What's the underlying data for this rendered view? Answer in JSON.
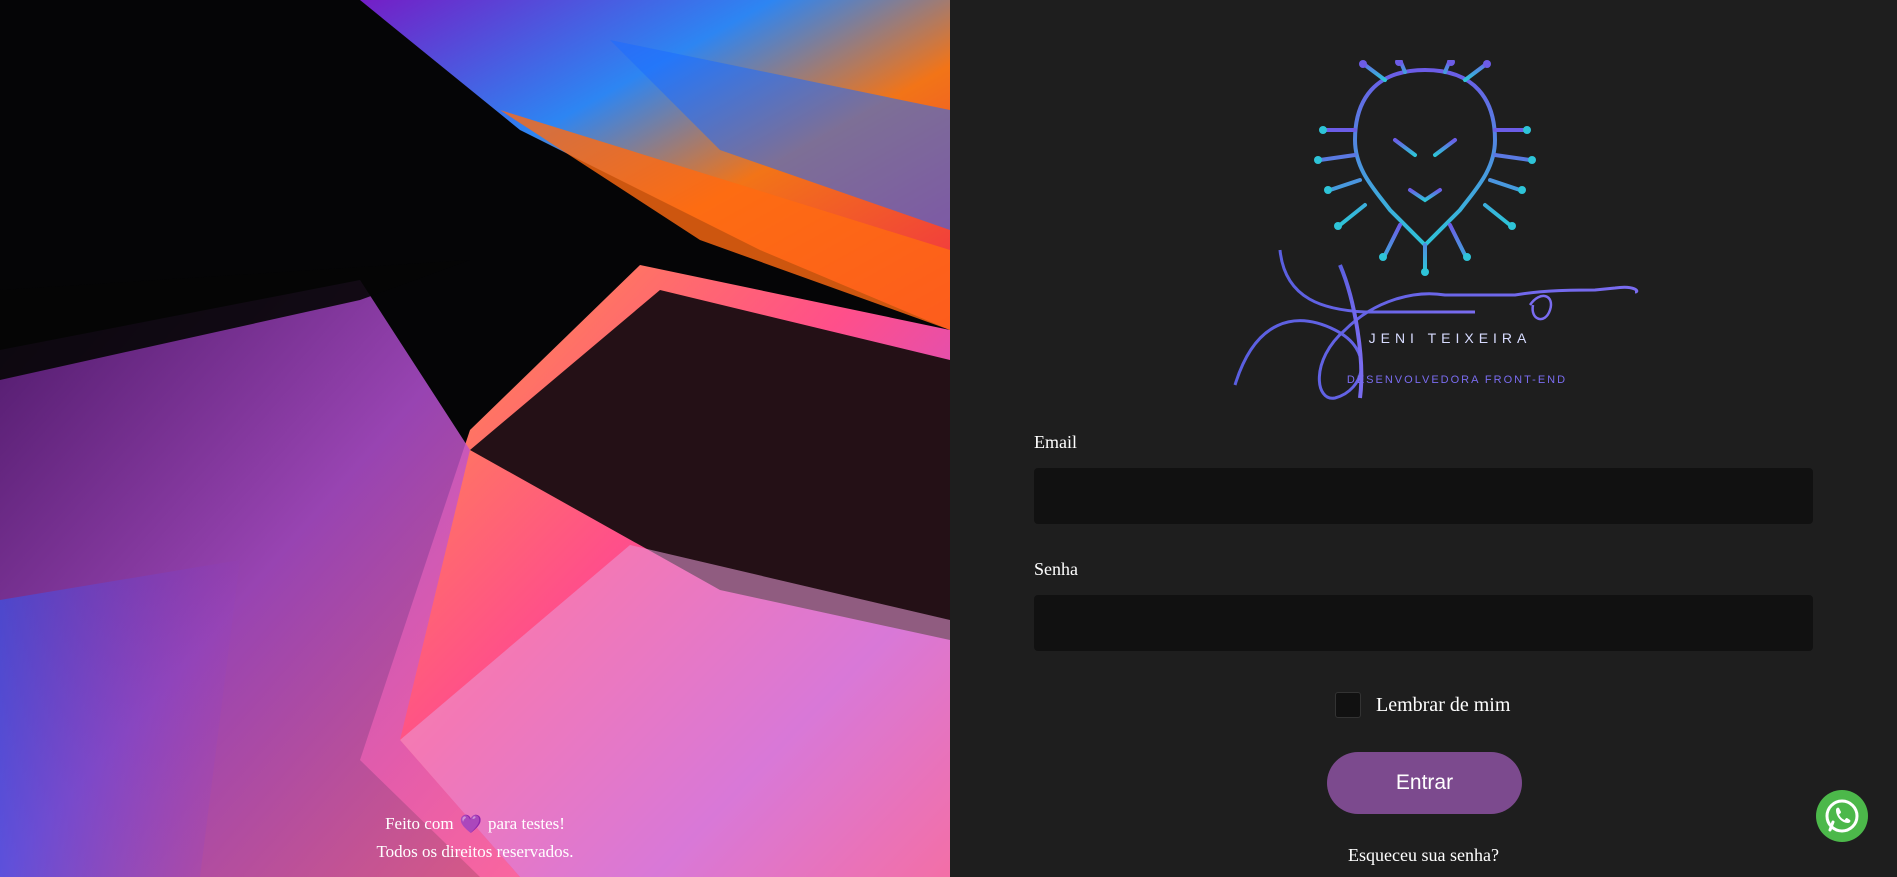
{
  "hero": {
    "image": "laptop-keyboard-neon-photo",
    "footer_line1_prefix": "Feito com",
    "footer_heart": "💜",
    "footer_line1_suffix": "para testes!",
    "footer_line2": "Todos os direitos reservados."
  },
  "logo": {
    "brand_name": "JENI TEIXEIRA",
    "tagline": "DESENVOLVEDORA FRONT-END",
    "script_text": "Jeni",
    "icon": "circuit-lion-icon"
  },
  "form": {
    "email_label": "Email",
    "email_value": "",
    "password_label": "Senha",
    "password_value": "",
    "remember_label": "Lembrar de mim",
    "remember_checked": false,
    "submit_label": "Entrar",
    "forgot_label": "Esqueceu sua senha?"
  },
  "floating": {
    "whatsapp_icon": "whatsapp-icon"
  },
  "colors": {
    "panel_bg": "#1e1e1e",
    "input_bg": "#111111",
    "button_bg": "#7c4a8e",
    "whatsapp": "#4cb84a",
    "logo_gradient_start": "#6c5ce7",
    "logo_gradient_end": "#2ec4d8"
  }
}
